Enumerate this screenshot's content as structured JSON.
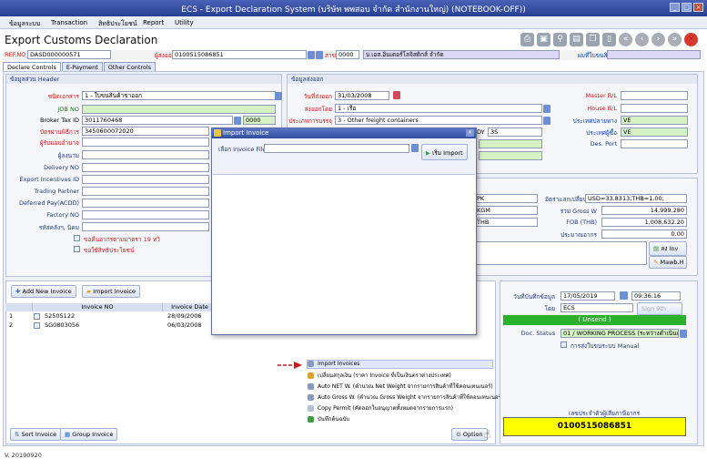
{
  "window": {
    "title": "ECS - Export Declaration System (บริษัท พพสอบ จำกัด   สำนักงานใหญ่) (NOTEBOOK-OFF))"
  },
  "menu": [
    "ข้อมูลระบบ",
    "Transaction",
    "สิทธิประโยชน์",
    "Report",
    "Utility"
  ],
  "page": {
    "title": "Export Customs Declaration"
  },
  "refbar": {
    "ref_label": "REF.NO",
    "ref_value": "DASD000000571",
    "exporter_label": "ผู้ส่งออก",
    "exporter_value": "0100515086851",
    "branch_label": "สาขา",
    "branch_value": "0000",
    "company_value": "บ.เอส.อินเตอร์โลจิสติกส์ จำกัด",
    "consign_label": "ผมที่ใบขนสินค้า"
  },
  "tabs": [
    "Declare Controls",
    "E-Payment",
    "Other Controls"
  ],
  "header_panel": {
    "title": "ข้อมูลส่วน Header",
    "fields": {
      "doc_type_label": "ชนิดเอกสาร",
      "doc_type_value": "1 - ใบขนสินค้าขาออก",
      "job_no_label": "JOB NO",
      "broker_tax_label": "Broker Tax ID",
      "broker_tax_value": "3011760468",
      "broker_branch_value": "0000",
      "broker_card_label": "บัตรผ่านพิธีการ",
      "broker_card_value": "3450600072020",
      "agent_label": "ผู้รับมอบอำนาจ",
      "signer_label": "ผู้ลงนาม",
      "delivery_no_label": "Delivery NO",
      "export_incentives_label": "Export Incentives ID",
      "trading_partner_label": "Trading Partner",
      "deferred_pay_label": "Deferred Pay(ACDD)",
      "factory_no_label": "Factory NO",
      "bond_label": "รหัสคลังฯ, นิคม",
      "check1_label": "ขอคืนอากรตามมาตรา 19 ทวิ",
      "check2_label": "ขอใช้สิทธิประโยชน์"
    }
  },
  "shipping_panel": {
    "title": "ข้อมูลส่งออก",
    "export_date_label": "วันที่ส่งออก",
    "export_date_value": "31/03/2008",
    "transport_label": "ส่งออกโดย",
    "transport_value": "1 - เรือ",
    "cargo_label": "ประเภทการบรรจุ",
    "cargo_value": "3 - Other freight containers",
    "master_bl_label": "Master B/L",
    "house_bl_label": "House B/L",
    "dest_country_label": "ประเทศปลายทาง",
    "dest_country_value": "VE",
    "buy_country_label": "ประเทศผู้ซื้อ",
    "buy_country_value": "VE",
    "des_port_label": "Des. Port",
    "dy_label": "DY",
    "dy_value": "3S"
  },
  "totals": {
    "pk": "PK",
    "kgm": "KGM",
    "thb": "THB",
    "rate_label": "อัตราแลกเปลี่ยน",
    "rate_value": "USD=33.8313;THB=1.00;",
    "gross_label": "รวม Gross W",
    "gross_value": "14,999.280",
    "fob_label": "FOB (THB)",
    "fob_value": "1,008,632.20",
    "duty_label": "ประมาณอากร",
    "duty_value": "0.00",
    "inv_button": "ลง Inv",
    "mawb_button": "Mawb.H"
  },
  "invoice_grid": {
    "add_button": "Add New Invoice",
    "import_button": "Import Invoice",
    "columns": [
      "Invoice NO",
      "Invoice Date"
    ],
    "rows": [
      {
        "num": "1",
        "invoice_no": "52505122",
        "date": "28/09/2006"
      },
      {
        "num": "2",
        "invoice_no": "SG0803056",
        "date": "06/03/2008"
      }
    ]
  },
  "status_panel": {
    "doc_date_label": "วันที่บันทึกข้อมูล",
    "doc_date_value": "17/05/2019",
    "doc_time_value": "09:36:16",
    "user_label": "โดย",
    "user_value": "ECS",
    "sign_button": "Sign 9th",
    "unsend": "( Unsend )",
    "doc_status_label": "Doc. Status",
    "doc_status_value": "01 / WORKING PROCESS (ระหว่างดำเนินการ)",
    "manual_label": "การส่งใบขนระบบ Manual",
    "exporter_id_label": "เลขประจำตัวผู้เสียภาษีอากร",
    "exporter_id_value": "0100515086851"
  },
  "modal": {
    "title": "Import Invoice",
    "file_label": "เลือก Invoice File",
    "import_button": "เริ่ม Import"
  },
  "options_menu": [
    "Import Invoices",
    "เปลี่ยนสกุลเงิน (ราคา Invoice ที่เป็นเงินตราต่างประเทศ)",
    "Auto NET W. (คำนวณ Net Weight จากรายการสินค้าที่ใช้คอนเทนเนอร์)",
    "Auto Gross W. (คำนวณ Gross Weight จากรายการสินค้าที่ใช้คอนเทนเนอร์)",
    "Copy Permit (คัดลอกใบอนุญาตทั้งหมดจากรายการแรก)",
    "บันทึกต้นฉบับ"
  ],
  "bottom": {
    "sort_button": "Sort Invoice",
    "group_button": "Group Invoice",
    "option_button": "Option",
    "version": "V. 20190920"
  },
  "colors": {
    "title_bar": "#2f4aa0",
    "accent_green": "#2bb02b",
    "highlight_yellow": "#ffff00",
    "arrow_red": "#d0161a"
  }
}
